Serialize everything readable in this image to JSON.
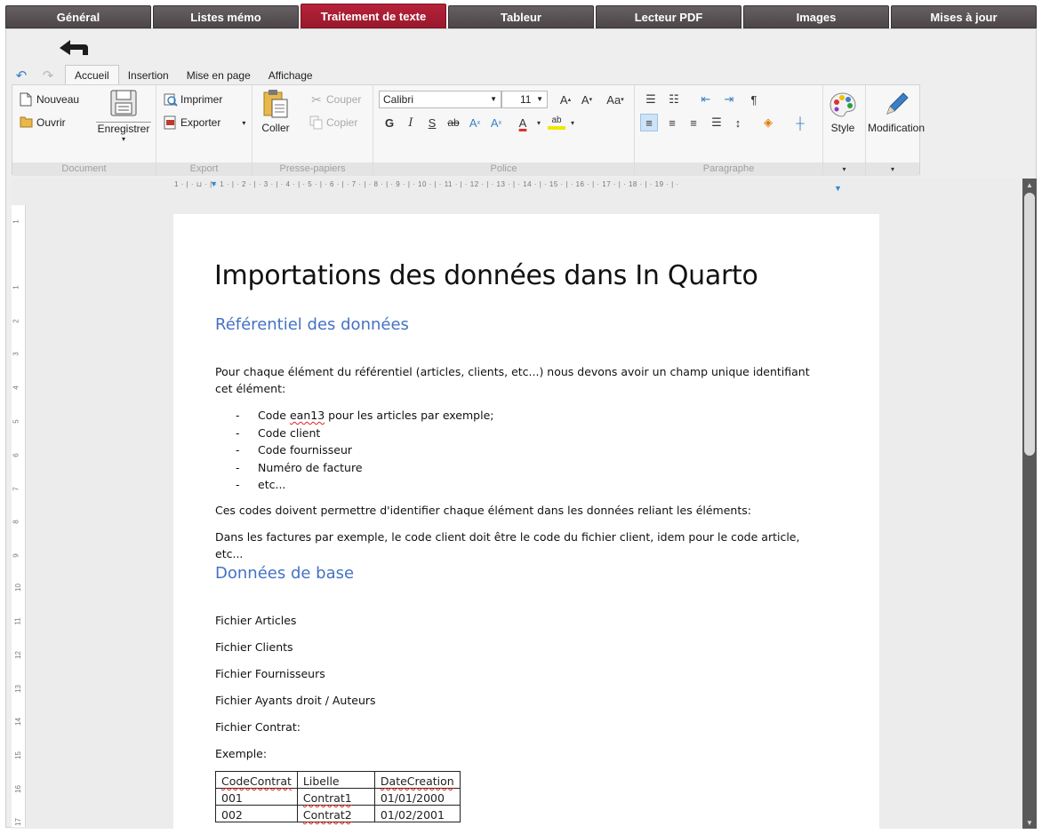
{
  "app_tabs": [
    "Général",
    "Listes mémo",
    "Traitement de texte",
    "Tableur",
    "Lecteur PDF",
    "Images",
    "Mises à jour"
  ],
  "ribbon_tabs": [
    "Accueil",
    "Insertion",
    "Mise en page",
    "Affichage"
  ],
  "ribbon": {
    "document": {
      "nouveau": "Nouveau",
      "ouvrir": "Ouvrir",
      "enregistrer": "Enregistrer",
      "label": "Document"
    },
    "export": {
      "imprimer": "Imprimer",
      "exporter": "Exporter",
      "label": "Export"
    },
    "clipboard": {
      "coller": "Coller",
      "couper": "Couper",
      "copier": "Copier",
      "label": "Presse-papiers"
    },
    "police": {
      "font": "Calibri",
      "size": "11",
      "label": "Police"
    },
    "paragraphe": {
      "label": "Paragraphe"
    },
    "style": {
      "label": "Style"
    },
    "modification": {
      "label": "Modification"
    }
  },
  "ruler": {
    "h_ticks": "1 · | · ⊔ · | · 1 · | · 2 · | · 3 · | · 4 · | · 5 · | · 6 · | · 7 · | · 8 · | · 9 · | · 10 · | · 11 · | · 12 · | · 13 · | · 14 · | · 15 · | · 16 · | · 17 · | · 18 · | · 19 · | ·",
    "v_ticks": [
      "1",
      "1",
      "2",
      "3",
      "4",
      "5",
      "6",
      "7",
      "8",
      "9",
      "10",
      "11",
      "12",
      "13",
      "14",
      "15",
      "16",
      "17"
    ]
  },
  "document": {
    "title": "Importations des données dans In Quarto",
    "heading1": "Référentiel des données",
    "para1": "Pour chaque élément du référentiel (articles, clients, etc...) nous devons avoir un champ unique identifiant cet élément:",
    "bullets": [
      {
        "prefix": "Code ",
        "squig": "ean13",
        "suffix": " pour les articles par exemple;"
      },
      {
        "prefix": "Code client",
        "squig": "",
        "suffix": ""
      },
      {
        "prefix": "Code fournisseur",
        "squig": "",
        "suffix": ""
      },
      {
        "prefix": "Numéro de facture",
        "squig": "",
        "suffix": ""
      },
      {
        "prefix": "etc...",
        "squig": "",
        "suffix": ""
      }
    ],
    "para2": "Ces codes doivent permettre d'identifier chaque élément dans les données reliant les éléments:",
    "para3": "Dans les factures par exemple, le code client doit être le code du fichier client, idem pour le code article, etc...",
    "heading2": "Données de base",
    "files": [
      "Fichier Articles",
      "Fichier Clients",
      "Fichier Fournisseurs",
      "Fichier Ayants droit / Auteurs",
      "Fichier Contrat:",
      "Exemple:"
    ],
    "table": {
      "header": [
        "CodeContrat",
        "Libelle",
        "DateCreation"
      ],
      "rows": [
        [
          "001",
          "Contrat1",
          "01/01/2000"
        ],
        [
          "002",
          "Contrat2",
          "01/02/2001"
        ]
      ]
    }
  },
  "colors": {
    "active_tab": "#a81f33",
    "tab_bg": "#5a5356",
    "heading": "#4472c4"
  }
}
